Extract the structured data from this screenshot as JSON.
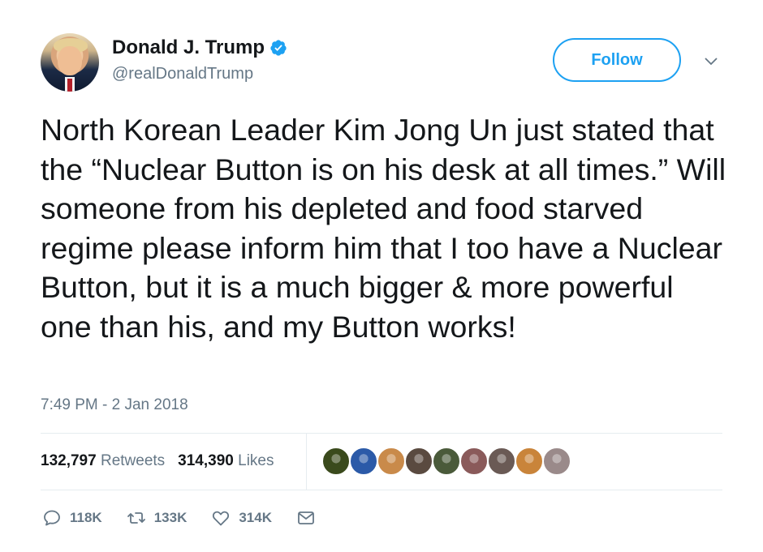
{
  "author": {
    "name": "Donald J. Trump",
    "handle": "@realDonaldTrump",
    "verified_icon": "verified-badge-icon"
  },
  "follow_button": {
    "label": "Follow"
  },
  "tweet": {
    "text": "North Korean Leader Kim Jong Un just stated that the “Nuclear Button is on his desk at all times.” Will someone from his depleted and food starved regime please inform him that I too have a Nuclear Button, but it is a much bigger & more powerful one than his, and my Button works!",
    "timestamp": "7:49 PM - 2 Jan 2018"
  },
  "stats": {
    "retweets_count": "132,797",
    "retweets_label": "Retweets",
    "likes_count": "314,390",
    "likes_label": "Likes"
  },
  "liker_avatars": [
    {
      "name": "liker-avatar-1",
      "color": "#3a4a1c"
    },
    {
      "name": "liker-avatar-2",
      "color": "#2b5aa8"
    },
    {
      "name": "liker-avatar-3",
      "color": "#c98a4a"
    },
    {
      "name": "liker-avatar-4",
      "color": "#5a4a40"
    },
    {
      "name": "liker-avatar-5",
      "color": "#4a5a3a"
    },
    {
      "name": "liker-avatar-6",
      "color": "#8a5a5a"
    },
    {
      "name": "liker-avatar-7",
      "color": "#6a5a55"
    },
    {
      "name": "liker-avatar-8",
      "color": "#c9843a"
    },
    {
      "name": "liker-avatar-9",
      "color": "#9a8a8a"
    }
  ],
  "actions": {
    "reply_count": "118K",
    "retweet_count": "133K",
    "like_count": "314K"
  },
  "colors": {
    "accent": "#1da1f2",
    "text": "#14171a",
    "secondary": "#657786",
    "divider": "#e6ecf0"
  }
}
